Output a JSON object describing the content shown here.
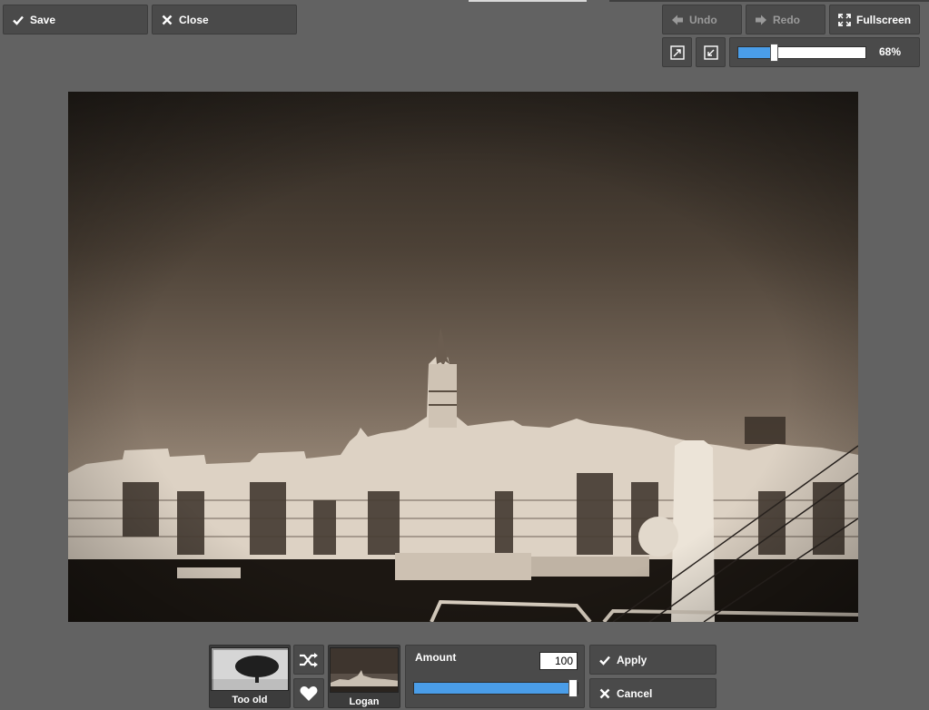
{
  "toolbar": {
    "save_label": "Save",
    "close_label": "Close",
    "undo_label": "Undo",
    "redo_label": "Redo",
    "fullscreen_label": "Fullscreen",
    "icons": {
      "save": "check-icon",
      "close": "x-icon",
      "undo": "arrow-left-icon",
      "redo": "arrow-right-icon",
      "fullscreen": "expand-icon",
      "zoom_fit": "zoom-fit-icon",
      "zoom_actual": "zoom-actual-icon"
    }
  },
  "zoom": {
    "value_label": "68%",
    "fraction": 0.28
  },
  "effects": {
    "current_preset": "Too old",
    "next_preset": "Logan",
    "shuffle_icon": "shuffle-icon",
    "favorite_icon": "heart-icon"
  },
  "amount": {
    "label": "Amount",
    "value": "100",
    "fraction": 1.0
  },
  "actions": {
    "apply_label": "Apply",
    "cancel_label": "Cancel"
  },
  "colors": {
    "background": "#626262",
    "button": "#4a4a4a",
    "accent": "#4a9de8"
  }
}
